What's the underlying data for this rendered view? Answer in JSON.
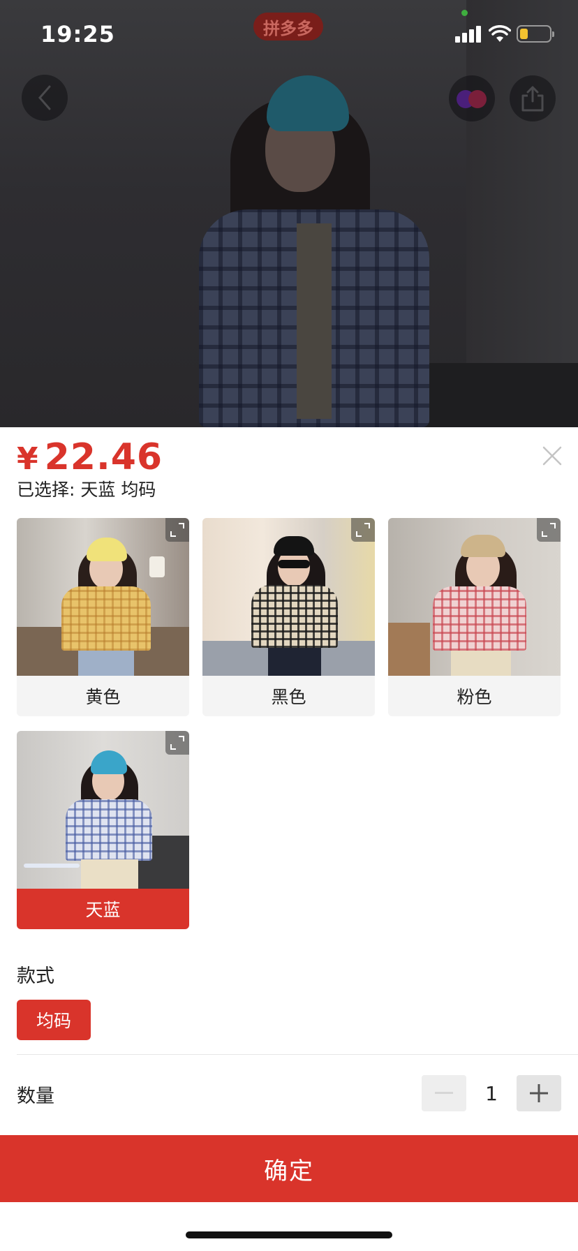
{
  "status_bar": {
    "time": "19:25",
    "app_badge": "拼多多",
    "icons": [
      "signal-icon",
      "wifi-icon",
      "battery-icon"
    ]
  },
  "nav": {
    "back_icon": "chevron-left-icon",
    "brand_icon": "brand-logo-icon",
    "share_icon": "share-icon"
  },
  "product": {
    "currency": "¥",
    "price": "22.46",
    "selected_text": "已选择: 天蓝 均码"
  },
  "colors": {
    "accent": "#d9342b",
    "chip_bg": "#f4f4f4"
  },
  "variants": [
    {
      "label": "黄色",
      "selected": false
    },
    {
      "label": "黑色",
      "selected": false
    },
    {
      "label": "粉色",
      "selected": false
    },
    {
      "label": "天蓝",
      "selected": true
    }
  ],
  "style_section": {
    "title": "款式",
    "options": [
      "均码"
    ],
    "selected": "均码"
  },
  "quantity": {
    "title": "数量",
    "value": "1"
  },
  "confirm": {
    "label": "确定"
  }
}
